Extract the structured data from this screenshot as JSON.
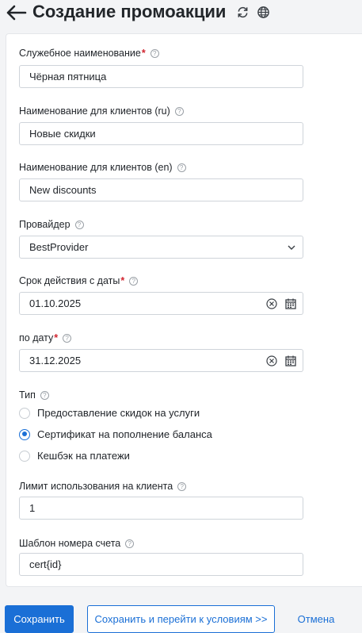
{
  "header": {
    "title": "Создание промоакции",
    "back_icon": "arrow-left-icon",
    "refresh_icon": "refresh-icon",
    "globe_icon": "globe-icon"
  },
  "form": {
    "internal_name": {
      "label": "Служебное наименование",
      "required_mark": "*",
      "value": "Чёрная пятница"
    },
    "client_name_ru": {
      "label": "Наименование для клиентов (ru)",
      "value": "Новые скидки"
    },
    "client_name_en": {
      "label": "Наименование для клиентов (en)",
      "value": "New discounts"
    },
    "provider": {
      "label": "Провайдер",
      "value": "BestProvider"
    },
    "date_from": {
      "label": "Срок действия с даты",
      "required_mark": "*",
      "value": "01.10.2025"
    },
    "date_to": {
      "label": "по дату",
      "required_mark": "*",
      "value": "31.12.2025"
    },
    "type": {
      "label": "Тип",
      "options": [
        {
          "label": "Предоставление скидок на услуги",
          "checked": false
        },
        {
          "label": "Сертификат на пополнение баланса",
          "checked": true
        },
        {
          "label": "Кешбэк на платежи",
          "checked": false
        }
      ]
    },
    "usage_limit": {
      "label": "Лимит использования на клиента",
      "value": "1"
    },
    "invoice_template": {
      "label": "Шаблон номера счета",
      "value": "cert{id}"
    },
    "help_glyph": "?"
  },
  "buttons": {
    "save": "Сохранить",
    "save_and_next": "Сохранить и перейти к условиям >>",
    "cancel": "Отмена"
  },
  "colors": {
    "accent": "#1a6fd6",
    "required": "#d1242f",
    "background": "#f3f4f6"
  }
}
